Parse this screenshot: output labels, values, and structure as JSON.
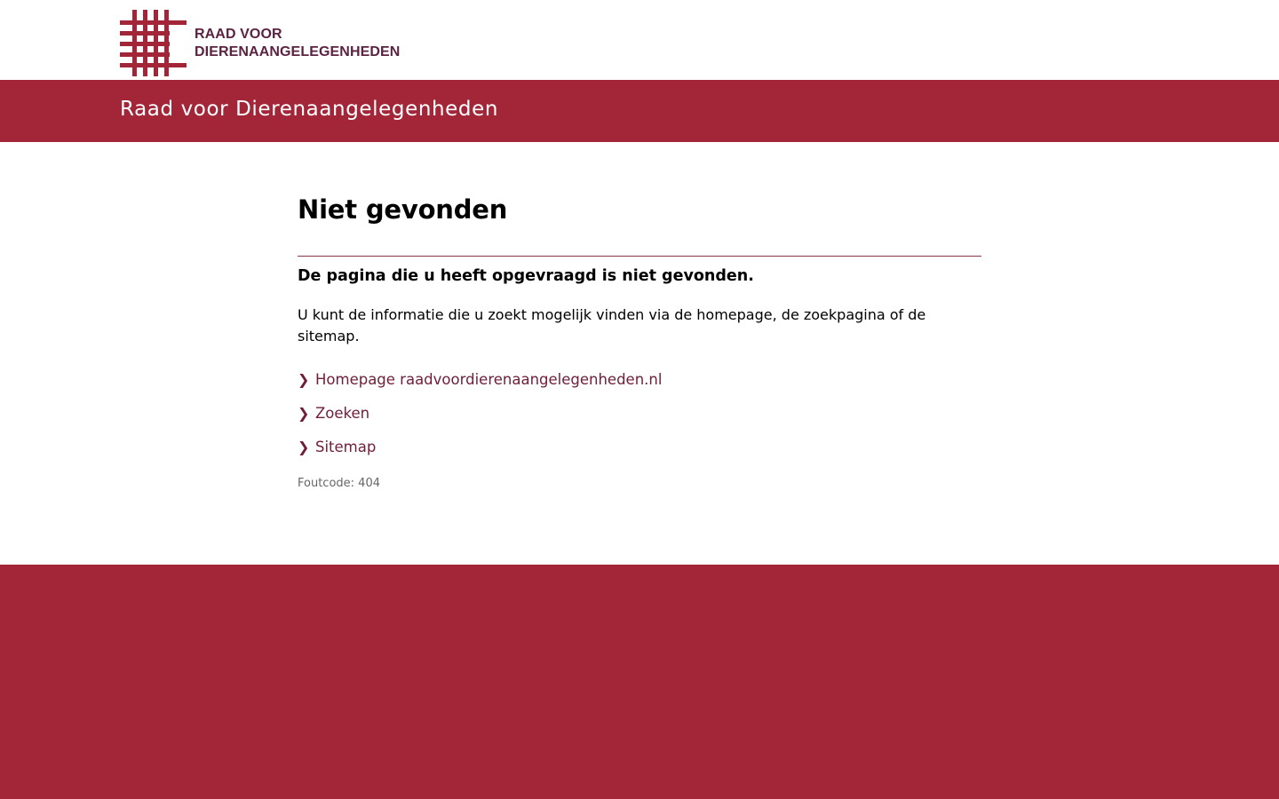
{
  "header": {
    "logo_line1": "RAAD VOOR",
    "logo_line2": "DIERENAANGELEGENHEDEN",
    "logo_icon": "grid-hash-logo-icon",
    "bar_title": "Raad voor Dierenaangelegenheden"
  },
  "main": {
    "title": "Niet gevonden",
    "lead": "De pagina die u heeft opgevraagd is niet gevonden.",
    "body": "U kunt de informatie die u zoekt mogelijk vinden via de homepage, de zoekpagina of de sitemap.",
    "links": [
      {
        "label": "Homepage raadvoordierenaangelegenheden.nl",
        "icon": "chevron-right-icon"
      },
      {
        "label": "Zoeken",
        "icon": "chevron-right-icon"
      },
      {
        "label": "Sitemap",
        "icon": "chevron-right-icon"
      }
    ],
    "error_code": "Foutcode: 404"
  },
  "colors": {
    "brand_red": "#a32638",
    "link_color": "#6e1e38",
    "logo_text": "#5b2242",
    "muted_text": "#666666"
  }
}
